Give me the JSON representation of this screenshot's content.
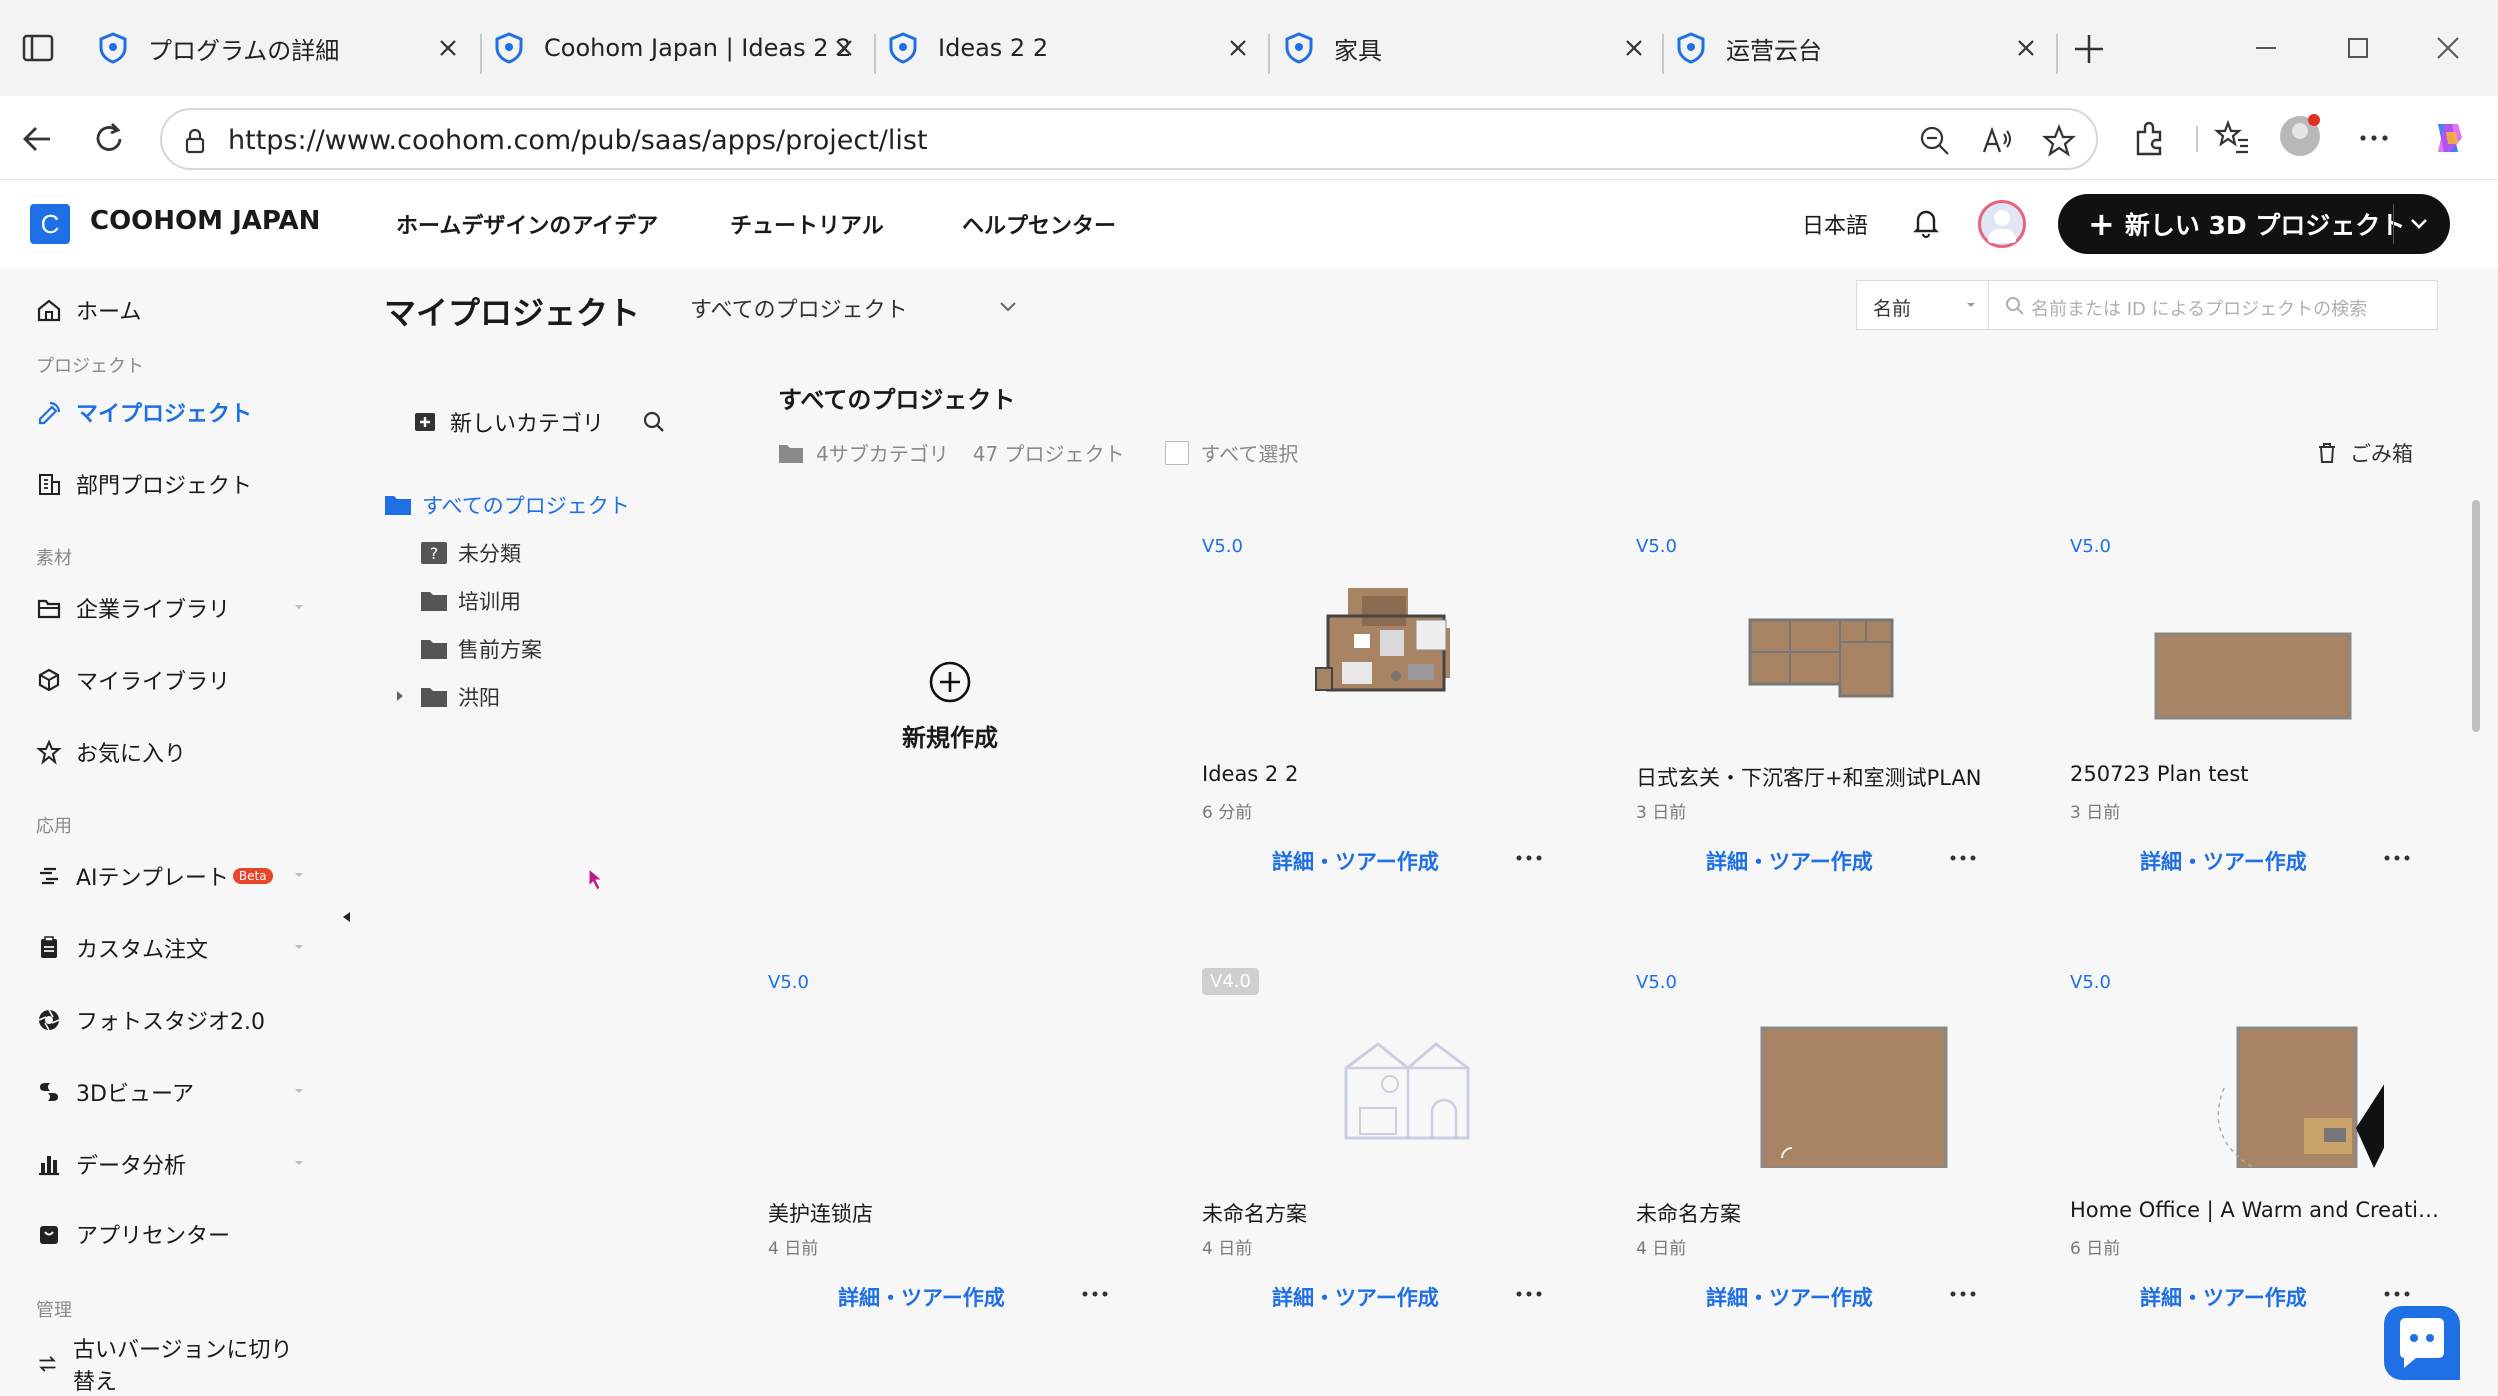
{
  "browser": {
    "tabs": [
      {
        "title": "プログラムの詳細"
      },
      {
        "title": "Coohom Japan | Ideas 2 2"
      },
      {
        "title": "Ideas 2 2"
      },
      {
        "title": "家具"
      },
      {
        "title": "运营云台"
      }
    ],
    "url": "https://www.coohom.com/pub/saas/apps/project/list"
  },
  "header": {
    "logo_letter": "C",
    "brand": "COOHOM JAPAN",
    "nav": [
      "ホームデザインのアイデア",
      "チュートリアル",
      "ヘルプセンター"
    ],
    "language": "日本語",
    "cta_label": "新しい 3D プロジェクト"
  },
  "sidebar": {
    "home": "ホーム",
    "section_project": "プロジェクト",
    "my_projects": "マイプロジェクト",
    "dept_projects": "部門プロジェクト",
    "section_material": "素材",
    "enterprise_lib": "企業ライブラリ",
    "my_lib": "マイライブラリ",
    "favorites": "お気に入り",
    "section_app": "応用",
    "ai_template": "AIテンプレート",
    "beta": "Beta",
    "custom_order": "カスタム注文",
    "photo_studio": "フォトスタジオ2.0",
    "viewer_3d": "3Dビューア",
    "data_analysis": "データ分析",
    "app_center": "アプリセンター",
    "section_admin": "管理",
    "old_version": "古いバージョンに切り替え"
  },
  "main": {
    "title": "マイプロジェクト",
    "filter": "すべてのプロジェクト",
    "sort": "名前",
    "search_placeholder": "名前または ID によるプロジェクトの検索",
    "new_category": "新しいカテゴリ",
    "tree": {
      "all": "すべてのプロジェクト",
      "uncategorized": "未分類",
      "training": "培训用",
      "presales": "售前方案",
      "hongyang": "洪阳"
    },
    "section_title": "すべてのプロジェクト",
    "subcats": "4サブカテゴリ",
    "project_count": "47 プロジェクト",
    "select_all": "すべて選択",
    "trash": "ごみ箱",
    "new_project": "新規作成",
    "detail_label": "詳細・ツアー作成"
  },
  "projects": [
    {
      "version": "V5.0",
      "name": "Ideas 2 2",
      "time": "6 分前"
    },
    {
      "version": "V5.0",
      "name": "日式玄关・下沉客厅+和室测试PLAN",
      "time": "3 日前"
    },
    {
      "version": "V5.0",
      "name": "250723 Plan test",
      "time": "3 日前"
    },
    {
      "version": "V5.0",
      "name": "美护连锁店",
      "time": "4 日前"
    },
    {
      "version": "V4.0",
      "name": "未命名方案",
      "time": "4 日前"
    },
    {
      "version": "V5.0",
      "name": "未命名方案",
      "time": "4 日前"
    },
    {
      "version": "V5.0",
      "name": "Home Office | A Warm and Creative…",
      "time": "6 日前"
    }
  ],
  "colors": {
    "accent": "#1f6fe5",
    "cta_bg": "#111111",
    "floor": "#a88464"
  }
}
